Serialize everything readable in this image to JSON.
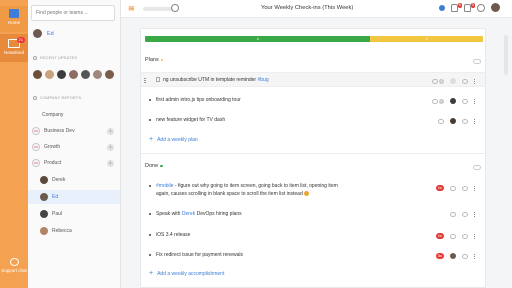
{
  "nav": {
    "home_label": "Home",
    "newsfeed_label": "Newsfeed",
    "newsfeed_badge": "21",
    "support_label": "Support chat"
  },
  "sidebar": {
    "search_placeholder": "Find people or teams ...",
    "me_name": "Ed",
    "recent_updates_heading": "RECENT UPDATES",
    "company_reports_heading": "COMPANY REPORTS",
    "tree": [
      {
        "label": "Company",
        "pct": "",
        "count": ""
      },
      {
        "label": "Business Dev",
        "pct": "0%",
        "count": "1"
      },
      {
        "label": "Growth",
        "pct": "0%",
        "count": "1"
      },
      {
        "label": "Product",
        "pct": "0%",
        "count": "4"
      },
      {
        "label": "Derek",
        "pct": "",
        "count": ""
      },
      {
        "label": "Ed",
        "pct": "",
        "count": ""
      },
      {
        "label": "Paul",
        "pct": "",
        "count": ""
      },
      {
        "label": "Rebecca",
        "pct": "",
        "count": ""
      }
    ],
    "avatar_colors": [
      "#6b4f3b",
      "#c9a27e",
      "#3c3c3c",
      "#8d6e63",
      "#555",
      "#a1887f",
      "#7b5e4a"
    ]
  },
  "topbar": {
    "title": "Your Weekly Check-ins (This Week)",
    "notif_badge_1": "6",
    "notif_badge_2": "9"
  },
  "progress": {
    "green_value": 4,
    "yellow_value": 2,
    "green_label": "4",
    "yellow_label": "2"
  },
  "plans": {
    "heading": "Plans",
    "items": [
      {
        "text": "ng unsubscribe UTM in template reminder ",
        "hash": "#bug",
        "count": "1"
      },
      {
        "text": "first admin intro.js tips onboarding tour",
        "hash": "",
        "count": "1"
      },
      {
        "text": "new feature widget for TV dash",
        "hash": "",
        "count": ""
      }
    ],
    "add_label": "Add a weekly plan"
  },
  "done": {
    "heading": "Done",
    "items": [
      {
        "hash": "#mobile",
        "text": " - figure out why going to item screen, going back to item list, opening item",
        "text2": "again, causes scrolling in blank space to scroll the item list instead",
        "pill": "1w",
        "count": ""
      },
      {
        "text": "Speak with ",
        "link": "Derek",
        "text_after": " DevOps hiring plans",
        "pill": "",
        "count": ""
      },
      {
        "text": "iOS 3.4 release",
        "pill": "1w",
        "count": ""
      },
      {
        "text": "Fix redirect issue for payment renewals",
        "pill": "3w",
        "count": ""
      }
    ],
    "add_label": "Add a weekly accomplishment"
  },
  "colors": {
    "accent_orange": "#f4a251",
    "link_blue": "#3b7dd8",
    "progress_green": "#38a946",
    "progress_yellow": "#f2c641",
    "badge_red": "#e53935"
  }
}
